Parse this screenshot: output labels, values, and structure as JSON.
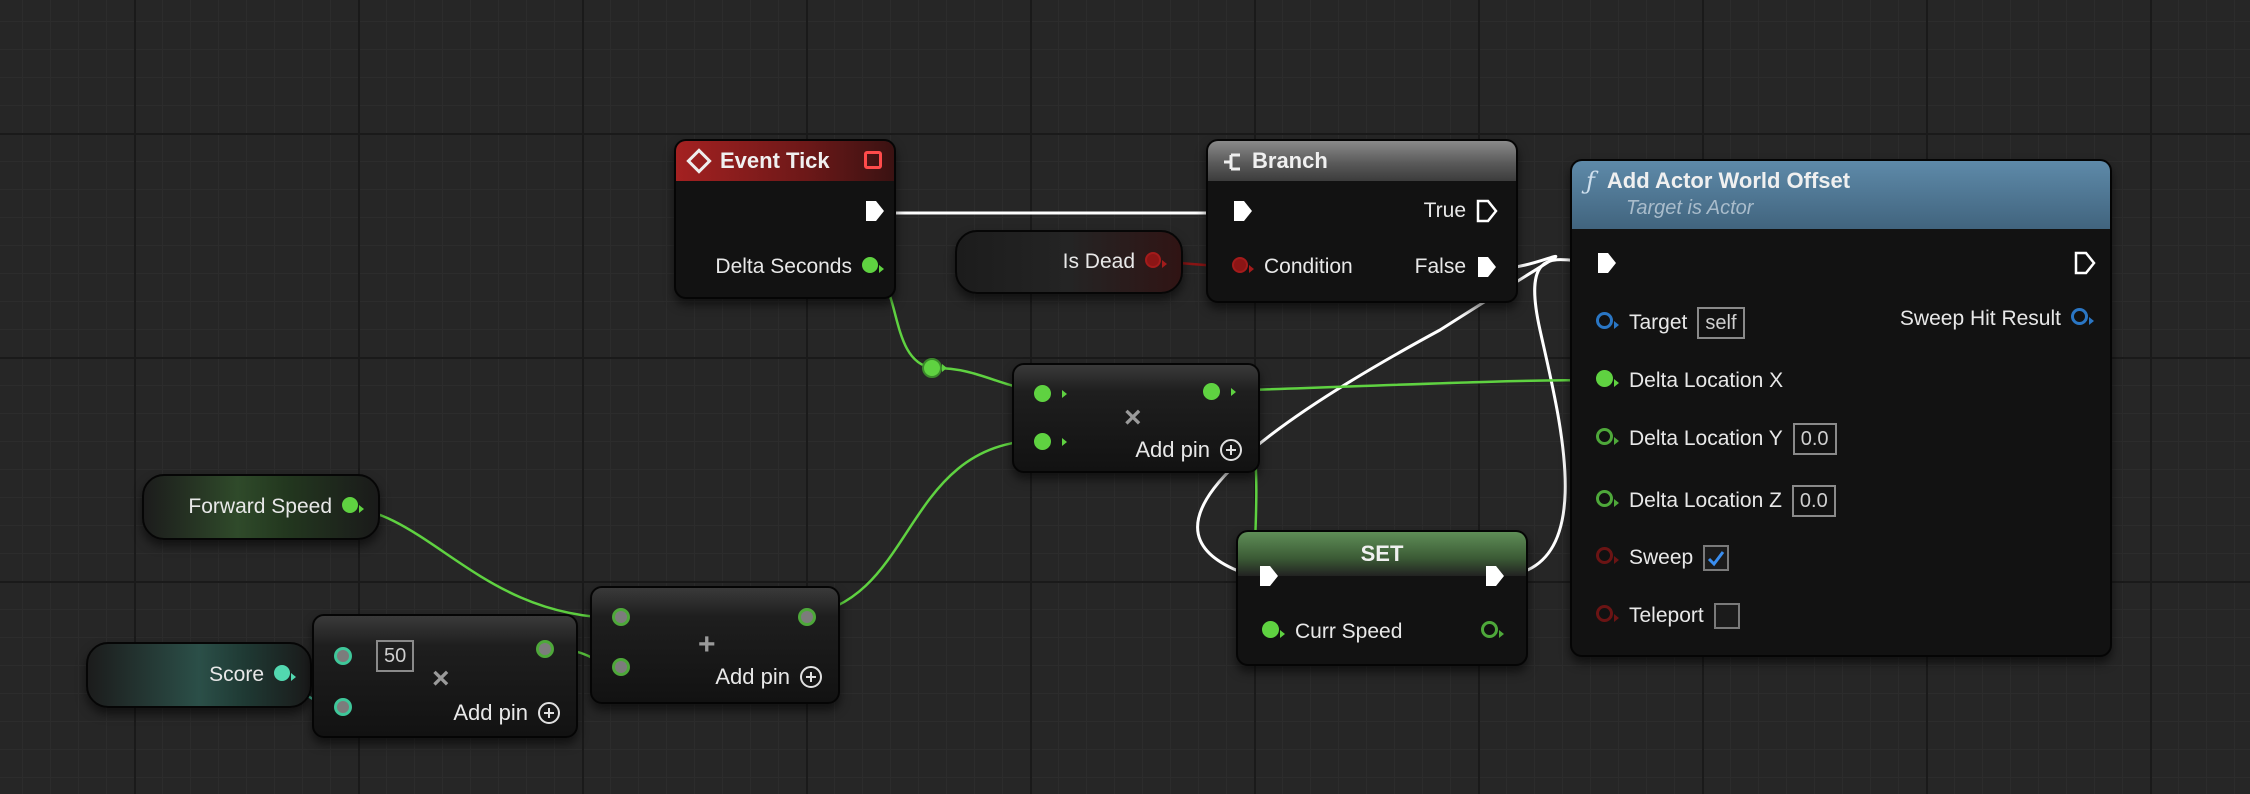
{
  "nodes": {
    "event_tick": {
      "title": "Event Tick",
      "delta_seconds": "Delta Seconds"
    },
    "branch": {
      "title": "Branch",
      "true_label": "True",
      "condition_label": "Condition",
      "false_label": "False"
    },
    "is_dead": {
      "label": "Is Dead"
    },
    "add_actor_world_offset": {
      "title": "Add Actor World Offset",
      "subtitle": "Target is Actor",
      "target_label": "Target",
      "target_value": "self",
      "sweep_hit_result_label": "Sweep Hit Result",
      "delta_x_label": "Delta Location X",
      "delta_y_label": "Delta Location Y",
      "delta_y_value": "0.0",
      "delta_z_label": "Delta Location Z",
      "delta_z_value": "0.0",
      "sweep_label": "Sweep",
      "sweep_checked": true,
      "teleport_label": "Teleport",
      "teleport_checked": false
    },
    "multiply_top": {
      "add_pin": "Add pin",
      "operator": "×"
    },
    "add_node": {
      "add_pin": "Add pin",
      "operator": "+"
    },
    "multiply_score": {
      "add_pin": "Add pin",
      "operator": "×",
      "literal_value": "50"
    },
    "forward_speed": {
      "label": "Forward Speed"
    },
    "score": {
      "label": "Score"
    },
    "set_node": {
      "title": "SET",
      "curr_speed_label": "Curr Speed"
    }
  },
  "colors": {
    "float_pin": "#5fd241",
    "bool_pin": "#a31b1b",
    "object_pin": "#2a76c4",
    "int_pin": "#52d8b0",
    "exec_wire": "#ffffff",
    "event_header": "#a42121",
    "function_header": "#5e8aa9"
  }
}
